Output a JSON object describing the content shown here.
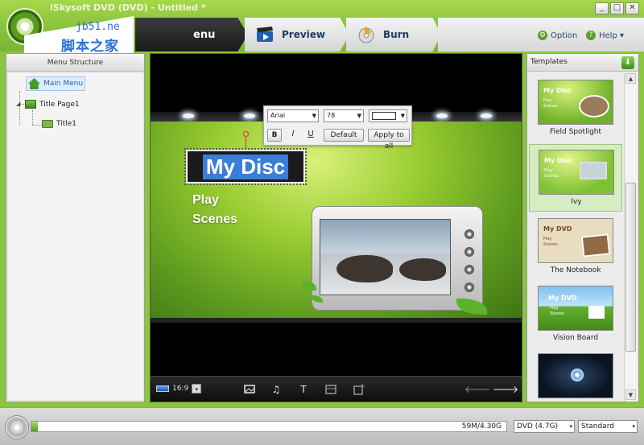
{
  "window": {
    "title": "iSkysoft DVD (DVD) - Untitled *",
    "minimize": "_",
    "maximize": "□",
    "close": "✕"
  },
  "watermark": {
    "url": "jb51.ne",
    "cn": "脚本之家"
  },
  "tabs": [
    {
      "label": "Menu",
      "visible_label": "enu",
      "active": true
    },
    {
      "label": "Preview",
      "icon": "clapper-icon"
    },
    {
      "label": "Burn",
      "icon": "burn-disc-icon"
    }
  ],
  "header_links": {
    "option": "Option",
    "help": "Help ▾"
  },
  "menu_structure": {
    "title": "Menu Structure",
    "items": [
      {
        "label": "Main Menu",
        "icon": "home-icon",
        "selected": true
      },
      {
        "label": "Title Page1",
        "icon": "page-icon",
        "expander": "◢"
      },
      {
        "label": "Title1",
        "icon": "folder-icon"
      }
    ]
  },
  "menu_canvas": {
    "disc_title": "My Disc",
    "buttons": [
      "Play",
      "Scenes"
    ],
    "colors": {
      "background": "#8fcd2e",
      "title_highlight": "#3a7ed8"
    }
  },
  "font_toolbar": {
    "font": "Arial",
    "size": "78",
    "color": "#ffffff",
    "bold": "B",
    "italic": "I",
    "underline": "U",
    "default_btn": "Default",
    "apply_all_btn": "Apply to all"
  },
  "preview_toolbar": {
    "aspect_ratio": "16:9",
    "icons": [
      "background-icon",
      "music-icon",
      "add-text-icon",
      "chapter-icon",
      "add-title-icon"
    ],
    "prev_arrow": "🡐",
    "next_arrow": "🡒"
  },
  "templates": {
    "title": "Templates",
    "download": "⬇",
    "items": [
      {
        "name": "Field Spotlight",
        "thumb_title": "My Disc",
        "thumb_lines": [
          "Play",
          "Scenes"
        ],
        "theme": "field"
      },
      {
        "name": "Ivy",
        "thumb_title": "My Disc",
        "thumb_lines": [
          "Play",
          "Scenes"
        ],
        "theme": "ivy",
        "selected": true
      },
      {
        "name": "The Notebook",
        "thumb_title": "My DVD",
        "thumb_lines": [
          "Play",
          "Scenes"
        ],
        "theme": "notebook"
      },
      {
        "name": "Vision Board",
        "thumb_title": "My DVD",
        "thumb_lines": [
          "Play",
          "Scenes"
        ],
        "theme": "vision"
      },
      {
        "name": "",
        "thumb_title": "",
        "thumb_lines": [],
        "theme": "dark"
      }
    ],
    "scroll_up": "▲",
    "scroll_down": "▼"
  },
  "status": {
    "usage": "59M/4.30G",
    "usage_fraction": 0.014,
    "disc_type": "DVD (4.7G)",
    "quality": "Standard",
    "dropdown": "▾"
  }
}
